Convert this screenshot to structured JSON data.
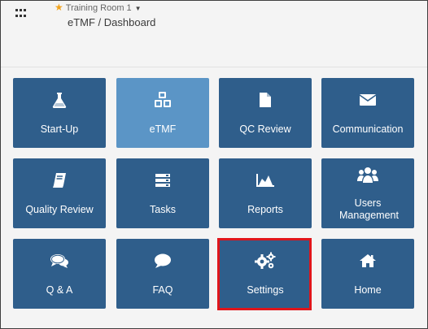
{
  "header": {
    "room_name": "Training Room 1",
    "breadcrumb": "eTMF / Dashboard"
  },
  "tiles": [
    {
      "label": "Start-Up",
      "icon": "flask-icon"
    },
    {
      "label": "eTMF",
      "icon": "cubes-icon"
    },
    {
      "label": "QC Review",
      "icon": "document-icon"
    },
    {
      "label": "Communication",
      "icon": "envelope-icon"
    },
    {
      "label": "Quality Review",
      "icon": "book-icon"
    },
    {
      "label": "Tasks",
      "icon": "server-icon"
    },
    {
      "label": "Reports",
      "icon": "area-chart-icon"
    },
    {
      "label": "Users Management",
      "icon": "users-icon"
    },
    {
      "label": "Q & A",
      "icon": "chat-bubbles-icon"
    },
    {
      "label": "FAQ",
      "icon": "speech-bubble-icon"
    },
    {
      "label": "Settings",
      "icon": "gears-icon"
    },
    {
      "label": "Home",
      "icon": "home-icon"
    }
  ],
  "colors": {
    "tile": "#2f5e8b",
    "tile_active": "#5b95c6",
    "highlight": "#e0151b",
    "star": "#f2a31b"
  },
  "active_tile": "eTMF",
  "highlighted_tile": "Settings"
}
